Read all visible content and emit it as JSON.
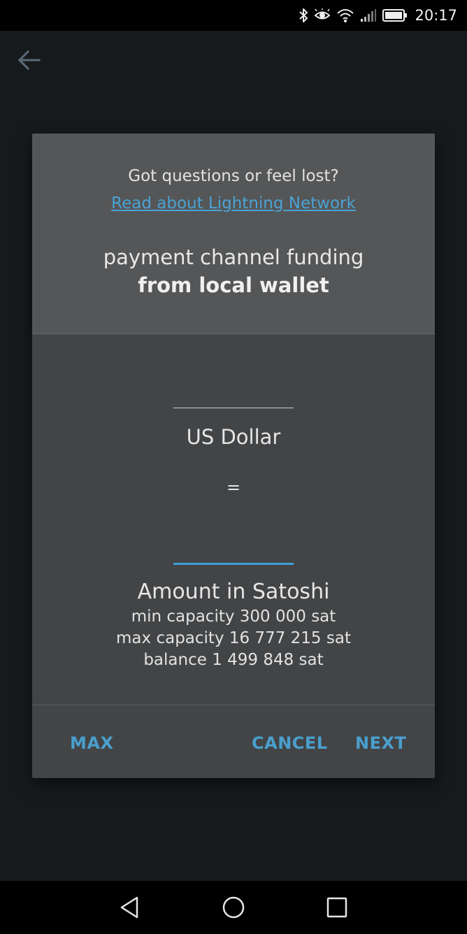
{
  "status_bar": {
    "time": "20:17",
    "icons": [
      "bluetooth-icon",
      "eye-icon",
      "wifi-icon",
      "signal-icon",
      "battery-icon"
    ]
  },
  "app_bar": {
    "back_icon": "arrow-left-icon"
  },
  "dialog": {
    "help_text": "Got questions or feel lost?",
    "help_link": "Read about Lightning Network",
    "title_line1": "payment channel funding",
    "title_line2": "from local wallet",
    "usd_input": {
      "value": ""
    },
    "usd_label": "US Dollar",
    "equals": "=",
    "sat_input": {
      "value": ""
    },
    "sat_label": "Amount in Satoshi",
    "min_capacity": "min capacity 300 000 sat",
    "max_capacity": "max capacity 16 777 215 sat",
    "balance": "balance 1 499 848 sat",
    "buttons": {
      "max": "MAX",
      "cancel": "CANCEL",
      "next": "NEXT"
    }
  },
  "nav_bar": {
    "icons": [
      "nav-back-icon",
      "nav-home-icon",
      "nav-recent-icon"
    ]
  },
  "colors": {
    "accent": "#4a9fcd",
    "link": "#4aa3d4",
    "dialog_bg": "#424446",
    "dialog_header_bg": "#555657",
    "screen_bg": "#171a1c"
  }
}
